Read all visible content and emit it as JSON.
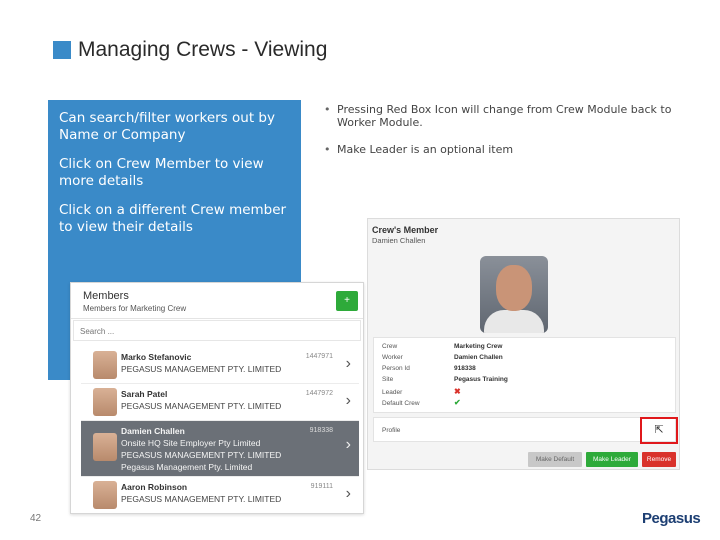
{
  "slide": {
    "title": "Managing Crews - Viewing",
    "page_number": "42",
    "logo": "Pegasus"
  },
  "callout": {
    "p1": "Can search/filter workers out by Name or Company",
    "p2": "Click on Crew Member to view more details",
    "p3": "Click on a different Crew member to view their details"
  },
  "bullets": [
    "Pressing Red Box Icon will change from Crew Module back to Worker Module.",
    "Make Leader is an optional item"
  ],
  "members_panel": {
    "title": "Members",
    "subtitle": "Members for Marketing Crew",
    "search_placeholder": "Search ...",
    "members": [
      {
        "name": "Marko Stefanovic",
        "line1": "PEGASUS MANAGEMENT PTY. LIMITED",
        "line2": "",
        "line3": "",
        "number": "1447971"
      },
      {
        "name": "Sarah Patel",
        "line1": "PEGASUS MANAGEMENT PTY. LIMITED",
        "line2": "",
        "line3": "",
        "number": "1447972"
      },
      {
        "name": "Damien Challen",
        "line1": "Onsite HQ Site Employer Pty Limited",
        "line2": "PEGASUS MANAGEMENT PTY. LIMITED",
        "line3": "Pegasus Management Pty. Limited",
        "number": "918338"
      },
      {
        "name": "Aaron Robinson",
        "line1": "PEGASUS MANAGEMENT PTY. LIMITED",
        "line2": "",
        "line3": "",
        "number": "919111"
      }
    ]
  },
  "crew_panel": {
    "title": "Crew's Member",
    "subtitle": "Damien Challen",
    "details": [
      {
        "label": "Crew",
        "value": "Marketing Crew"
      },
      {
        "label": "Worker",
        "value": "Damien Challen"
      },
      {
        "label": "Person Id",
        "value": "918338"
      },
      {
        "label": "Site",
        "value": "Pegasus Training"
      },
      {
        "label": "Leader",
        "value": "✖"
      },
      {
        "label": "Default Crew",
        "value": "✔"
      }
    ],
    "profile_label": "Profile",
    "buttons": {
      "make_default": "Make Default",
      "make_leader": "Make Leader",
      "remove": "Remove"
    }
  },
  "colors": {
    "accent_blue": "#3a8ac8",
    "success_green": "#2eaa3a",
    "danger_red": "#d9322b",
    "highlight_red": "#e0181b",
    "selected_row": "#6b7077"
  },
  "icons": {
    "add": "add-member-icon",
    "chevron": "chevron-right-icon",
    "profile": "open-profile-icon"
  }
}
